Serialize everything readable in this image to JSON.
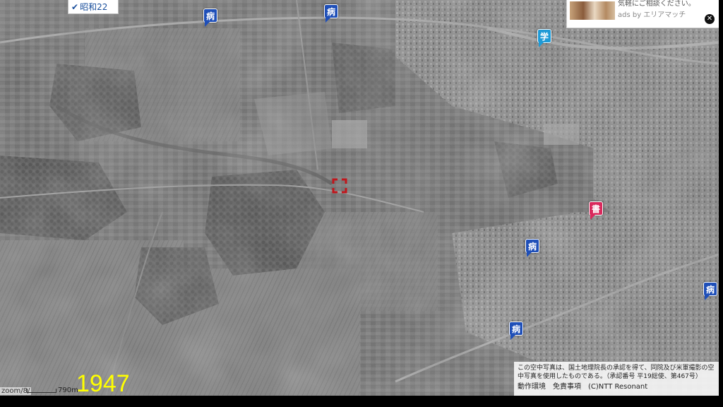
{
  "era_toggle": {
    "label": "昭和22",
    "checked": true
  },
  "year": "1947",
  "scale": {
    "zoom_text": "zoom/8/",
    "distance": "790m"
  },
  "ad": {
    "text": "気軽にご相談ください。",
    "by": "ads by エリアマッチ",
    "close_icon": "close-icon"
  },
  "copyright": {
    "note": "この空中写真は、国土地理院長の承認を得て、同院及び米軍撮影の空中写真を使用したものである。（承認番号 平19総使、第467号）",
    "links": [
      "動作環境",
      "免責事項",
      "(C)NTT Resonant"
    ]
  },
  "markers": [
    {
      "type": "hospital",
      "glyph": "病",
      "icon": "hospital-icon"
    },
    {
      "type": "hospital",
      "glyph": "病",
      "icon": "hospital-icon"
    },
    {
      "type": "school",
      "glyph": "学",
      "icon": "school-icon"
    },
    {
      "type": "library",
      "glyph": "書",
      "icon": "library-icon"
    },
    {
      "type": "hospital",
      "glyph": "病",
      "icon": "hospital-icon"
    },
    {
      "type": "hospital",
      "glyph": "病",
      "icon": "hospital-icon"
    },
    {
      "type": "hospital",
      "glyph": "病",
      "icon": "hospital-icon"
    }
  ],
  "colors": {
    "hospital_marker": "#1f4fb8",
    "school_marker": "#1e9ad6",
    "library_marker": "#d9285c",
    "year_label": "#ffff00",
    "crosshair": "#c0161c"
  }
}
